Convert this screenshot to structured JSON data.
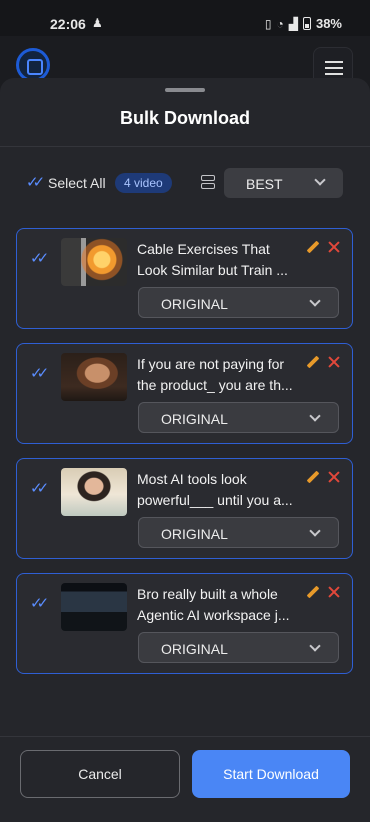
{
  "status_bar": {
    "time": "22:06",
    "battery": "38%"
  },
  "sheet": {
    "title": "Bulk Download"
  },
  "select_all": {
    "label": "Select All",
    "count_badge": "4 video",
    "quality": "BEST"
  },
  "items": [
    {
      "title_line1": "Cable Exercises That",
      "title_line2": "Look Similar but Train ...",
      "format": "ORIGINAL",
      "thumb": "gym-fire"
    },
    {
      "title_line1": "If you are not paying for",
      "title_line2": "the product_ you are th...",
      "format": "ORIGINAL",
      "thumb": "woman-portrait"
    },
    {
      "title_line1": "Most AI tools look",
      "title_line2": "powerful___ until you a...",
      "format": "ORIGINAL",
      "thumb": "woman-smiling"
    },
    {
      "title_line1": "Bro really built a whole",
      "title_line2": "Agentic AI workspace j...",
      "format": "ORIGINAL",
      "thumb": "dark-workspace"
    }
  ],
  "footer": {
    "cancel": "Cancel",
    "start": "Start Download"
  },
  "colors": {
    "accent": "#4a86f5",
    "card_border": "#2f5fd4",
    "edit": "#e89a2a",
    "remove": "#e2483b"
  }
}
